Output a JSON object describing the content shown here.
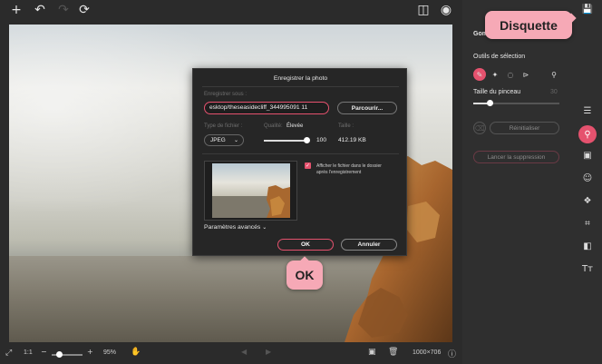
{
  "toolbar": {
    "icons": [
      "add-icon",
      "undo-icon",
      "redo-icon",
      "refresh-icon",
      "compare-icon",
      "preview-icon",
      "save-icon"
    ]
  },
  "modal": {
    "title": "Enregistrer la photo",
    "save_as_label": "Enregistrer sous :",
    "path_value": "esktop/theseasidecliff_344995091 11",
    "browse_label": "Parcourir...",
    "file_type_label": "Type de fichier :",
    "file_type_value": "JPEG",
    "quality_label": "Qualité:",
    "quality_level": "Élevée",
    "quality_value": "100",
    "size_label": "Taille :",
    "size_value": "412.19 KB",
    "show_file_checked": true,
    "show_file_label": "Afficher le fichier dans le dossier après l'enregistrement",
    "advanced_label": "Paramètres avancés",
    "ok_label": "OK",
    "cancel_label": "Annuler"
  },
  "panel": {
    "heading": "Gom",
    "selection_tools_label": "Outils de sélection",
    "brush_size_label": "Taille du pinceau",
    "brush_size_value": "30",
    "reset_label": "Réinitialiser",
    "run_erase_label": "Lancer la suppression"
  },
  "bottombar": {
    "zoom_ratio": "1:1",
    "zoom_percent": "95%",
    "dimensions": "1000×706"
  },
  "callouts": {
    "disquette": "Disquette",
    "ok": "OK"
  },
  "colors": {
    "accent": "#e5526e",
    "callout": "#f6a9b6"
  }
}
